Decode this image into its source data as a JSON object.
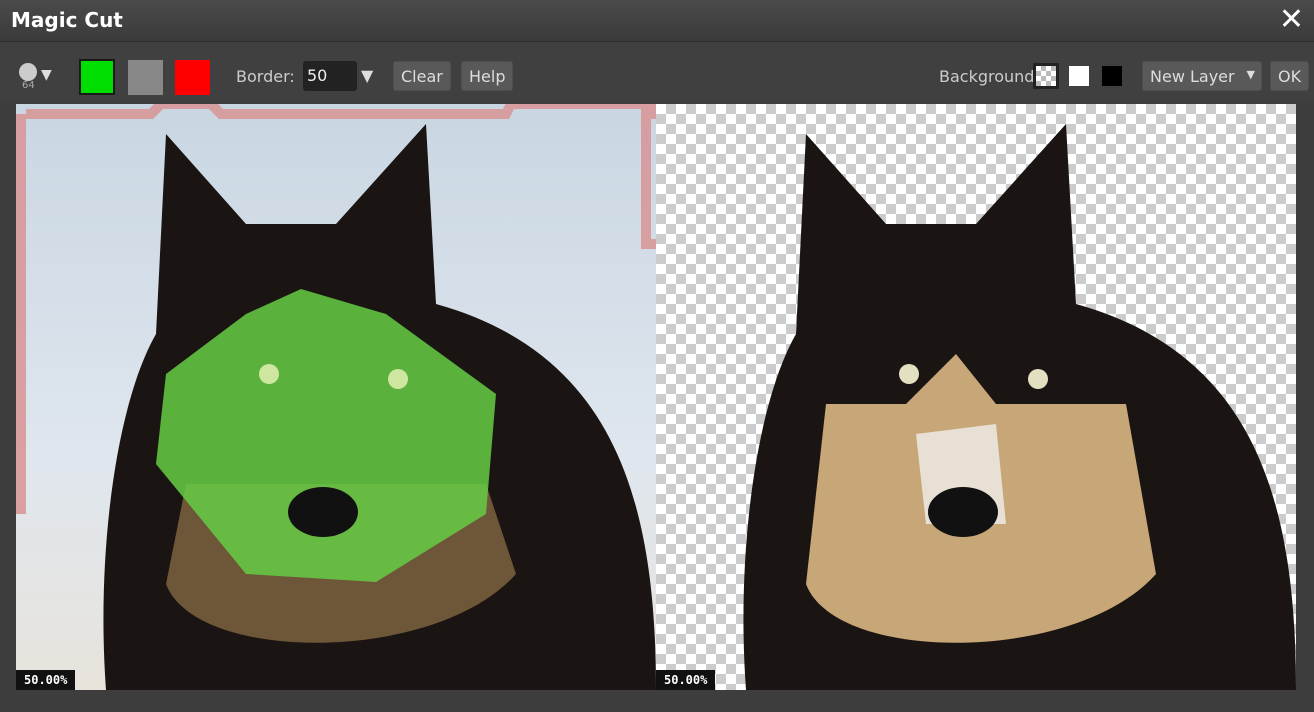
{
  "window": {
    "title": "Magic Cut",
    "close_icon": "close-icon"
  },
  "toolbar": {
    "brush_size": "64",
    "swatch_colors": {
      "keep": "#00dd00",
      "neutral": "#888888",
      "remove": "#ff0000"
    },
    "border_label": "Border:",
    "border_value": "50",
    "clear_label": "Clear",
    "help_label": "Help",
    "background_label": "Background:",
    "output_select": "New Layer",
    "ok_label": "OK"
  },
  "left_view": {
    "zoom": "50.00%"
  },
  "right_view": {
    "zoom": "50.00%"
  }
}
